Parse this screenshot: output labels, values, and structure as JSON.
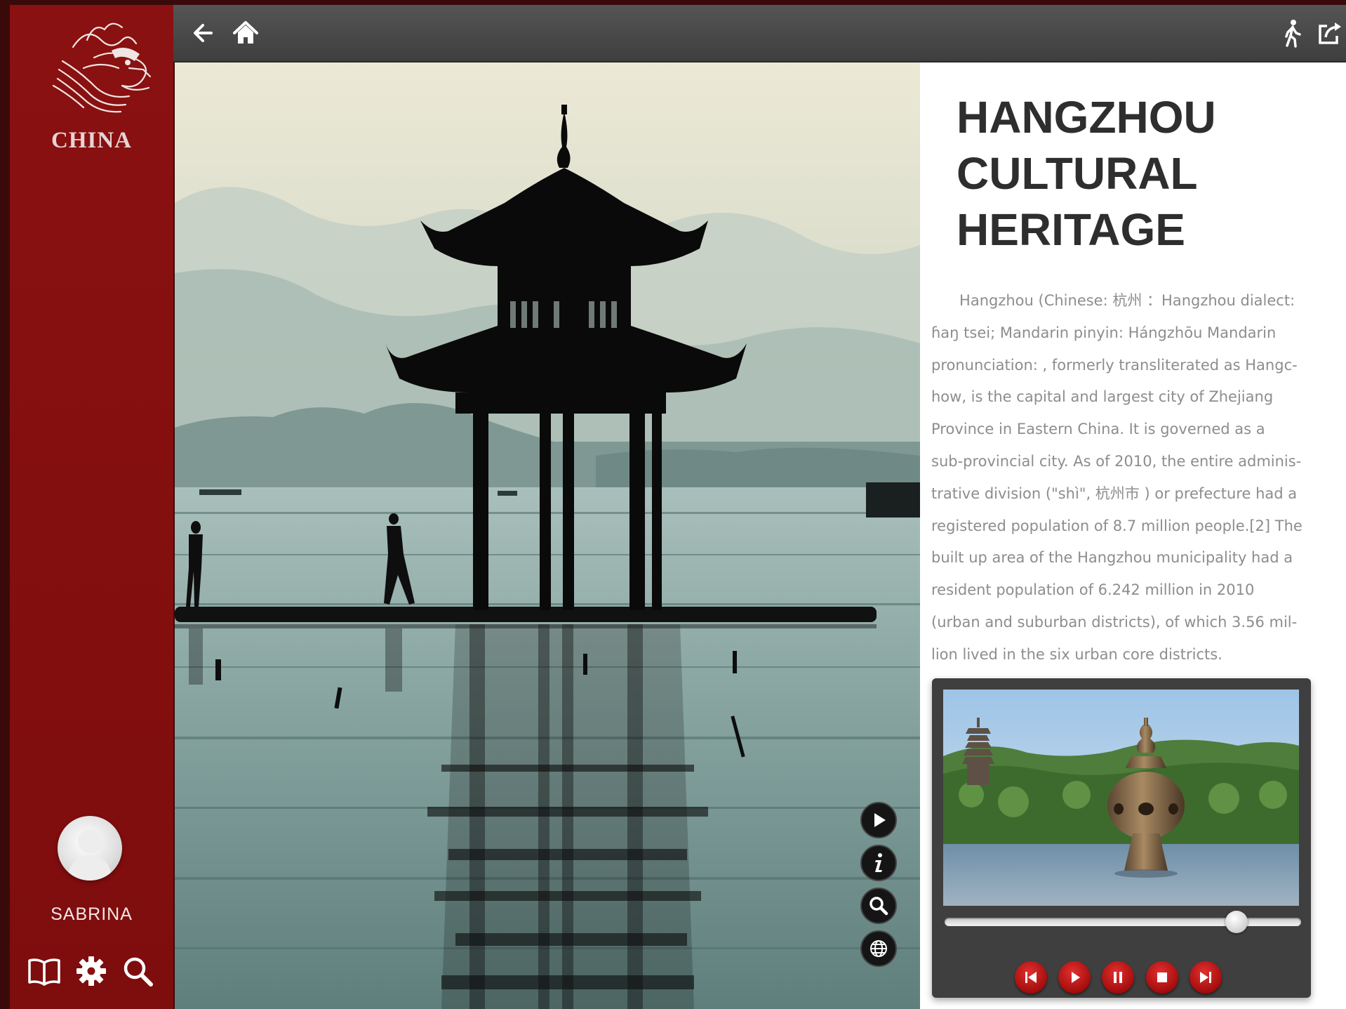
{
  "app": {
    "brand": "CHINA",
    "user_name": "SABRINA"
  },
  "sidebar": {
    "bottom_icons": [
      "book-icon",
      "gear-icon",
      "search-icon"
    ]
  },
  "topbar": {
    "left_icons": [
      "back-arrow-icon",
      "home-icon"
    ],
    "right_icons": [
      "walking-person-icon",
      "share-icon"
    ]
  },
  "photo": {
    "action_icons": [
      "play-icon",
      "info-icon",
      "zoom-icon",
      "globe-icon"
    ]
  },
  "article": {
    "title_lines": [
      "HANGZHOU",
      "CULTURAL",
      "HERITAGE"
    ],
    "body_lines": [
      "      Hangzhou (Chinese: 杭州 ：Hangzhou dialect:",
      "ɦaŋ tsei; Mandarin pinyin: Hángzhōu Mandarin",
      "pronunciation: , formerly transliterated as Hangc-",
      "how, is the capital and largest city of Zhejiang",
      "Province in Eastern China. It is governed as a",
      "sub-provincial city. As of 2010, the entire adminis-",
      "trative division (\"shì\", 杭州市 ) or prefecture had a",
      "registered population of 8.7 million people.[2] The",
      "built up area of the Hangzhou municipality had a",
      "resident population of 6.242 million in 2010",
      "(urban and suburban districts), of which 3.56 mil-",
      "lion lived in the six urban core districts."
    ]
  },
  "player": {
    "progress_fraction": 0.84,
    "controls": [
      "skip-back-icon",
      "play-icon",
      "pause-icon",
      "stop-icon",
      "skip-forward-icon"
    ]
  },
  "colors": {
    "sidebar_red": "#8a1111",
    "control_red": "#c01414",
    "topbar_gray": "#4a4a4a"
  }
}
